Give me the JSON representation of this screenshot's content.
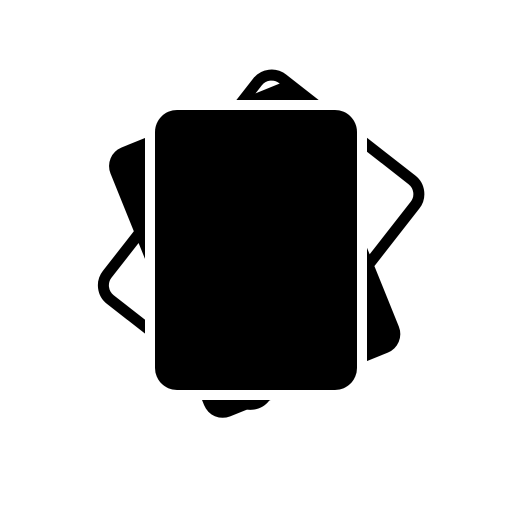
{
  "icon": {
    "name": "card-stack-icon",
    "background": "#ffffff",
    "ink": "#000000"
  }
}
